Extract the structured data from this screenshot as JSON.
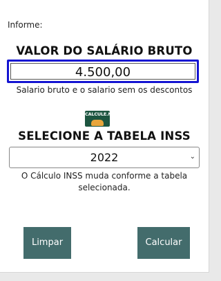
{
  "form": {
    "prompt": "Informe:",
    "salary_heading": "VALOR DO SALÁRIO BRUTO",
    "salary_value": "4.500,00",
    "salary_help": "Salario bruto e o salario sem os descontos",
    "logo_text": "CALCULE.NET",
    "table_heading": "SELECIONE A TABELA INSS",
    "table_selected": "2022",
    "table_help": "O Cálculo INSS muda conforme a tabela selecionada."
  },
  "buttons": {
    "clear_label": "Limpar",
    "calculate_label": "Calcular"
  },
  "colors": {
    "focus_border": "#1414d2",
    "button_bg": "#436c6c",
    "logo_bg": "#1d5540"
  }
}
